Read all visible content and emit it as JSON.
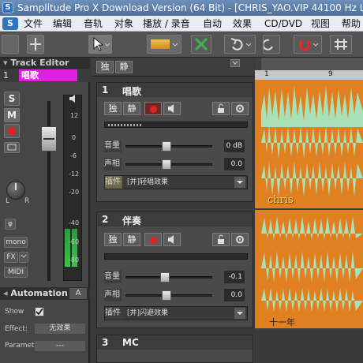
{
  "window": {
    "title": "Samplitude Pro X Download Version (64 Bit) - [CHRIS_YAO.VIP   44100 Hz L:"
  },
  "menu": {
    "logo": "S",
    "items": [
      "文件",
      "编辑",
      "音轨",
      "对象",
      "播放 / 录音",
      "自动",
      "效果",
      "CD/DVD",
      "视图",
      "帮助"
    ]
  },
  "track_editor": {
    "title": "Track Editor",
    "track_number": "1",
    "track_name": "唱歌",
    "solo": "S",
    "mute": "M",
    "meter_scale": [
      "12",
      "0",
      "-6",
      "-12",
      "-20",
      "-40",
      "-60",
      "-80"
    ],
    "pan_left": "L",
    "pan_right": "R",
    "phase": "φ",
    "mono": "mono",
    "fx": "FX",
    "midi": "MIDI",
    "automation_title": "Automation",
    "automation_tab": "A",
    "show_label": "Show",
    "effect_label": "Effect:",
    "effect_value": "无效果",
    "parameter_label": "Parameter",
    "parameter_value": "---"
  },
  "track_list_header": {
    "solo_label": "独",
    "mute_label": "静"
  },
  "tracks": [
    {
      "number": "1",
      "name": "唱歌",
      "solo": "独",
      "mute": "静",
      "volume_label": "音量",
      "volume_value": "0 dB",
      "pan_label": "声相",
      "pan_value": "0.0",
      "plugin_label": "插件",
      "plugin_value": "[并]轻唱效果",
      "color": "#d020d0"
    },
    {
      "number": "2",
      "name": "伴奏",
      "solo": "独",
      "mute": "静",
      "volume_label": "音量",
      "volume_value": "-0.1",
      "pan_label": "声相",
      "pan_value": "0.0",
      "plugin_label": "插件",
      "plugin_value": "[并]闪避效果",
      "color": "#f0e6a0"
    },
    {
      "number": "3",
      "name": "MC",
      "color": "#22c8e0"
    }
  ],
  "arrange": {
    "ruler_marks": [
      "1",
      "9"
    ],
    "clip1_label": "chris",
    "clip2_label": "十一年",
    "wave_color": "#a8e0b8",
    "clip_bg": "#e08020"
  }
}
